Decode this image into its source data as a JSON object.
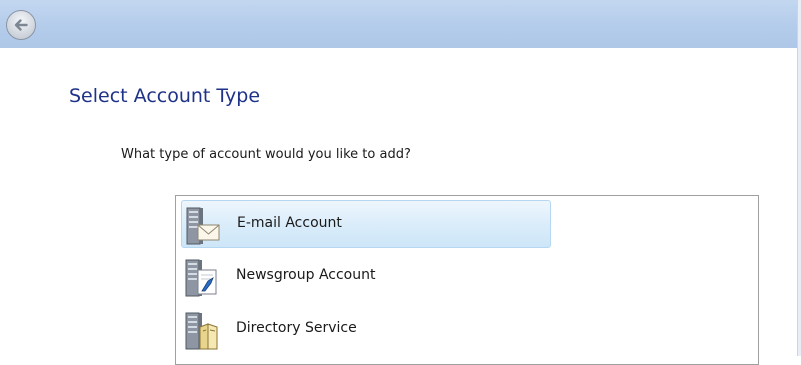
{
  "header": {
    "back_icon": "back-arrow-icon"
  },
  "main": {
    "title": "Select Account Type",
    "question": "What type of account would you like to add?"
  },
  "account_types": [
    {
      "label": "E-mail Account",
      "icon": "email-server-icon",
      "selected": true
    },
    {
      "label": "Newsgroup Account",
      "icon": "newsgroup-server-icon",
      "selected": false
    },
    {
      "label": "Directory Service",
      "icon": "directory-server-icon",
      "selected": false
    }
  ],
  "colors": {
    "title": "#1e3287",
    "header_bar": "#b5cdeb",
    "selection": "#d9ecfa"
  }
}
